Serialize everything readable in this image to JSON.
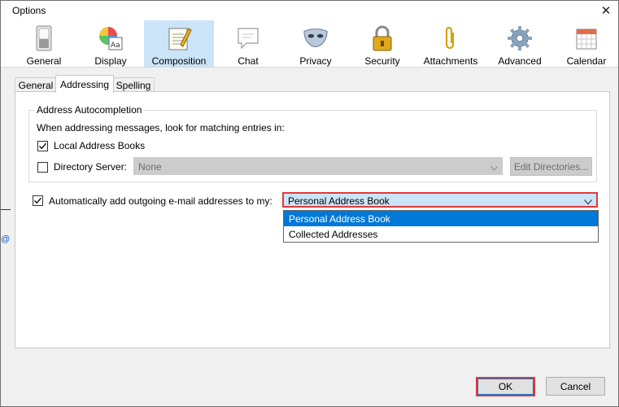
{
  "window": {
    "title": "Options",
    "close_glyph": "✕"
  },
  "panes": [
    {
      "label": "General",
      "icon": "switch-icon"
    },
    {
      "label": "Display",
      "icon": "display-palette-icon"
    },
    {
      "label": "Composition",
      "icon": "composition-notepad-icon",
      "selected": true
    },
    {
      "label": "Chat",
      "icon": "chat-bubble-icon"
    },
    {
      "label": "Privacy",
      "icon": "mask-icon"
    },
    {
      "label": "Security",
      "icon": "padlock-icon"
    },
    {
      "label": "Attachments",
      "icon": "paperclip-icon"
    },
    {
      "label": "Advanced",
      "icon": "gear-icon"
    },
    {
      "label": "Calendar",
      "icon": "calendar-icon"
    }
  ],
  "tabs": [
    {
      "label": "General"
    },
    {
      "label": "Addressing",
      "active": true
    },
    {
      "label": "Spelling"
    }
  ],
  "autocompletion": {
    "legend": "Address Autocompletion",
    "intro": "When addressing messages, look for matching entries in:",
    "local_books": {
      "label": "Local Address Books",
      "checked": true
    },
    "directory_server": {
      "label": "Directory Server:",
      "checked": false,
      "value": "None"
    },
    "edit_directories_label": "Edit Directories..."
  },
  "outgoing": {
    "label": "Automatically add outgoing e-mail addresses to my:",
    "checked": true,
    "selected": "Personal Address Book",
    "options": [
      "Personal Address Book",
      "Collected Addresses"
    ],
    "highlighted_index": 0
  },
  "buttons": {
    "ok": "OK",
    "cancel": "Cancel"
  },
  "background_fragments": {
    "at_sign": "@"
  },
  "colors": {
    "selected_pane": "#cce4f7",
    "highlight": "#0078d7",
    "focus_outline": "#e03a3a"
  }
}
